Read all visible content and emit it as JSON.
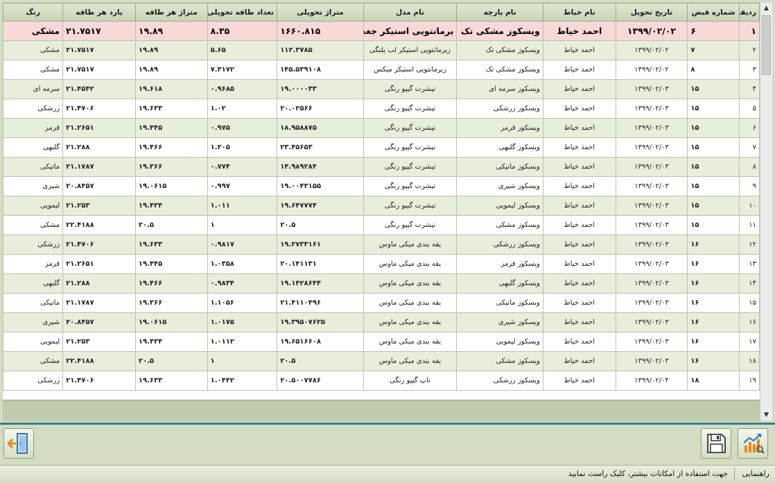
{
  "headers": {
    "row": "ردیف",
    "receipt": "شماره قبض",
    "date": "تاریخ تحویل",
    "tailor": "نام خیاط",
    "fabric": "نام پارچه",
    "model": "نام مدل",
    "meter": "متراژ تحویلی",
    "count": "تعداد طاقه تحویلی",
    "meter_per": "متراژ هر طاقه",
    "yard_per": "یارد هر طاقه",
    "color": "رنگ"
  },
  "rows": [
    {
      "row": "۱",
      "receipt": "۶",
      "date": "۱۳۹۹/۰۲/۰۲",
      "tailor": "احمد خیاط",
      "fabric": "ویسکوز مشکی تک",
      "model": "یرمانتویی استیکر جغد",
      "meter": "۱۶۶۰.۸۱۵",
      "count": "۸.۳۵",
      "meter_per": "۱۹.۸۹",
      "yard_per": "۲۱.۷۵۱۷",
      "color": "مشکی"
    },
    {
      "row": "۲",
      "receipt": "۷",
      "date": "۱۳۹۹/۰۲/۰۲",
      "tailor": "احمد خیاط",
      "fabric": "ویسکوز مشکی تک",
      "model": "زیرمانتویی استیکر لب پلنگی",
      "meter": "۱۱۲.۳۷۸۵",
      "count": "۵.۶۵",
      "meter_per": "۱۹.۸۹",
      "yard_per": "۲۱.۷۵۱۷",
      "color": "مشکی"
    },
    {
      "row": "۳",
      "receipt": "۸",
      "date": "۱۳۹۹/۰۲/۰۲",
      "tailor": "احمد خیاط",
      "fabric": "ویسکوز مشکی تک",
      "model": "زیرمانتویی استیکر میکس",
      "meter": "۱۴۵.۵۳۹۱۰۸",
      "count": "۷.۳۱۷۲",
      "meter_per": "۱۹.۸۹",
      "yard_per": "۲۱.۷۵۱۷",
      "color": "مشکی"
    },
    {
      "row": "۴",
      "receipt": "۱۵",
      "date": "۱۳۹۹/۰۲/۰۳",
      "tailor": "احمد خیاط",
      "fabric": "ویسکوز سرمه ای",
      "model": "تیشرت گیپو رنگی",
      "meter": "۱۹.۰۰۰۰۳۳",
      "count": "۰.۹۶۸۵",
      "meter_per": "۱۹.۶۱۸",
      "yard_per": "۲۱.۴۵۴۲",
      "color": "سرمه ای"
    },
    {
      "row": "۵",
      "receipt": "۱۵",
      "date": "۱۳۹۹/۰۲/۰۳",
      "tailor": "احمد خیاط",
      "fabric": "ویسکوز زرشکی",
      "model": "تیشرت گیپو رنگی",
      "meter": "۲۰.۰۲۵۶۶",
      "count": "۱.۰۲",
      "meter_per": "۱۹.۶۳۳",
      "yard_per": "۲۱.۴۷۰۶",
      "color": "زرشکی"
    },
    {
      "row": "۶",
      "receipt": "۱۵",
      "date": "۱۳۹۹/۰۲/۰۳",
      "tailor": "احمد خیاط",
      "fabric": "ویسکوز قرمز",
      "model": "تیشرت گیپو رنگی",
      "meter": "۱۸.۹۵۸۸۷۵",
      "count": "۰.۹۷۵",
      "meter_per": "۱۹.۴۴۵",
      "yard_per": "۲۱.۲۶۵۱",
      "color": "قرمز"
    },
    {
      "row": "۷",
      "receipt": "۱۵",
      "date": "۱۳۹۹/۰۲/۰۳",
      "tailor": "احمد خیاط",
      "fabric": "ویسکوز گلبهی",
      "model": "تیشرت گیپو رنگی",
      "meter": "۲۳.۴۵۶۵۳",
      "count": "۱.۲۰۵",
      "meter_per": "۱۹.۴۶۶",
      "yard_per": "۲۱.۲۸۸",
      "color": "گلبهی"
    },
    {
      "row": "۸",
      "receipt": "۱۵",
      "date": "۱۳۹۹/۰۲/۰۳",
      "tailor": "احمد خیاط",
      "fabric": "ویسکوز ماتیکی",
      "model": "تیشرت گیپو رنگی",
      "meter": "۱۴.۹۸۹۲۸۴",
      "count": "۰.۷۷۴",
      "meter_per": "۱۹.۳۶۶",
      "yard_per": "۲۱.۱۷۸۷",
      "color": "ماتیکی"
    },
    {
      "row": "۹",
      "receipt": "۱۵",
      "date": "۱۳۹۹/۰۲/۰۳",
      "tailor": "احمد خیاط",
      "fabric": "ویسکوز شیری",
      "model": "تیشرت گیپو رنگی",
      "meter": "۱۹.۰۰۴۳۱۵۵",
      "count": "۰.۹۹۷",
      "meter_per": "۱۹.۰۶۱۵",
      "yard_per": "۲۰.۸۴۵۷",
      "color": "شیری"
    },
    {
      "row": "۱۰",
      "receipt": "۱۵",
      "date": "۱۳۹۹/۰۲/۰۳",
      "tailor": "احمد خیاط",
      "fabric": "ویسکوز لیمویی",
      "model": "تیشرت گیپو رنگی",
      "meter": "۱۹.۶۴۷۷۷۴",
      "count": "۱.۰۱۱",
      "meter_per": "۱۹.۴۳۴",
      "yard_per": "۲۱.۲۵۳",
      "color": "لیمویی"
    },
    {
      "row": "۱۱",
      "receipt": "۱۵",
      "date": "۱۳۹۹/۰۲/۰۳",
      "tailor": "احمد خیاط",
      "fabric": "ویسکوز مشکی",
      "model": "تیشرت گیپو رنگی",
      "meter": "۲۰.۵",
      "count": "۱",
      "meter_per": "۲۰.۵",
      "yard_per": "۲۲.۴۱۸۸",
      "color": "مشکی"
    },
    {
      "row": "۱۲",
      "receipt": "۱۶",
      "date": "۱۳۹۹/۰۲/۰۳",
      "tailor": "احمد خیاط",
      "fabric": "ویسکوز زرشکی",
      "model": "یقه بندی میکی ماوس",
      "meter": "۱۹.۲۷۳۳۱۶۱",
      "count": "۰.۹۸۱۷",
      "meter_per": "۱۹.۶۳۳",
      "yard_per": "۲۱.۴۷۰۶",
      "color": "زرشکی"
    },
    {
      "row": "۱۳",
      "receipt": "۱۶",
      "date": "۱۳۹۹/۰۲/۰۳",
      "tailor": "احمد خیاط",
      "fabric": "ویسکوز قرمز",
      "model": "یقه بندی میکی ماوس",
      "meter": "۲۰.۱۴۱۱۳۱",
      "count": "۱.۰۳۵۸",
      "meter_per": "۱۹.۴۴۵",
      "yard_per": "۲۱.۲۶۵۱",
      "color": "قرمز"
    },
    {
      "row": "۱۴",
      "receipt": "۱۶",
      "date": "۱۳۹۹/۰۲/۰۳",
      "tailor": "احمد خیاط",
      "fabric": "ویسکوز گلبهی",
      "model": "یقه بندی میکی ماوس",
      "meter": "۱۹.۱۴۲۸۶۴۴",
      "count": "۰.۹۸۳۴",
      "meter_per": "۱۹.۴۶۶",
      "yard_per": "۲۱.۲۸۸",
      "color": "گلبهی"
    },
    {
      "row": "۱۵",
      "receipt": "۱۶",
      "date": "۱۳۹۹/۰۲/۰۳",
      "tailor": "احمد خیاط",
      "fabric": "ویسکوز ماتیکی",
      "model": "یقه بندی میکی ماوس",
      "meter": "۲۱.۴۱۱۰۴۹۶",
      "count": "۱.۱۰۵۶",
      "meter_per": "۱۹.۳۶۶",
      "yard_per": "۲۱.۱۷۸۷",
      "color": "ماتیکی"
    },
    {
      "row": "۱۶",
      "receipt": "۱۶",
      "date": "۱۳۹۹/۰۲/۰۳",
      "tailor": "احمد خیاط",
      "fabric": "ویسکوز شیری",
      "model": "یقه بندی میکی ماوس",
      "meter": "۱۹.۳۹۵۰۷۶۲۵",
      "count": "۱.۰۱۷۵",
      "meter_per": "۱۹.۰۶۱۵",
      "yard_per": "۲۰.۸۴۵۷",
      "color": "شیری"
    },
    {
      "row": "۱۷",
      "receipt": "۱۶",
      "date": "۱۳۹۹/۰۲/۰۳",
      "tailor": "احمد خیاط",
      "fabric": "ویسکوز لیمویی",
      "model": "یقه بندی میکی ماوس",
      "meter": "۱۹.۶۵۱۶۶۰۸",
      "count": "۱.۰۱۱۲",
      "meter_per": "۱۹.۴۳۴",
      "yard_per": "۲۱.۲۵۳",
      "color": "لیمویی"
    },
    {
      "row": "۱۸",
      "receipt": "۱۶",
      "date": "۱۳۹۹/۰۲/۰۳",
      "tailor": "احمد خیاط",
      "fabric": "ویسکوز مشکی",
      "model": "یقه بندی میکی ماوس",
      "meter": "۲۰.۵",
      "count": "۱",
      "meter_per": "۲۰.۵",
      "yard_per": "۲۲.۴۱۸۸",
      "color": "مشکی"
    },
    {
      "row": "۱۹",
      "receipt": "۱۸",
      "date": "۱۳۹۹/۰۲/۰۴",
      "tailor": "احمد خیاط",
      "fabric": "ویسکوز زرشکی",
      "model": "تاپ گیپو رنگی",
      "meter": "۲۰.۵۰۰۷۷۸۶",
      "count": "۱.۰۴۴۲",
      "meter_per": "۱۹.۶۳۳",
      "yard_per": "۲۱.۴۷۰۶",
      "color": "زرشکی"
    }
  ],
  "toolbar": {
    "exit_icon": "exit-door-icon",
    "save_icon": "floppy-disk-icon",
    "report_icon": "chart-report-icon"
  },
  "status": {
    "label": "راهنمایی",
    "hint": "جهت استفاده از امکانات بیشتر، کلیک راست نمایید"
  },
  "colors": {
    "row_alt": "#e7eedb",
    "selected_row": "#f8d8d8",
    "header": "#c7d3b5",
    "divider": "#2e7f93"
  }
}
